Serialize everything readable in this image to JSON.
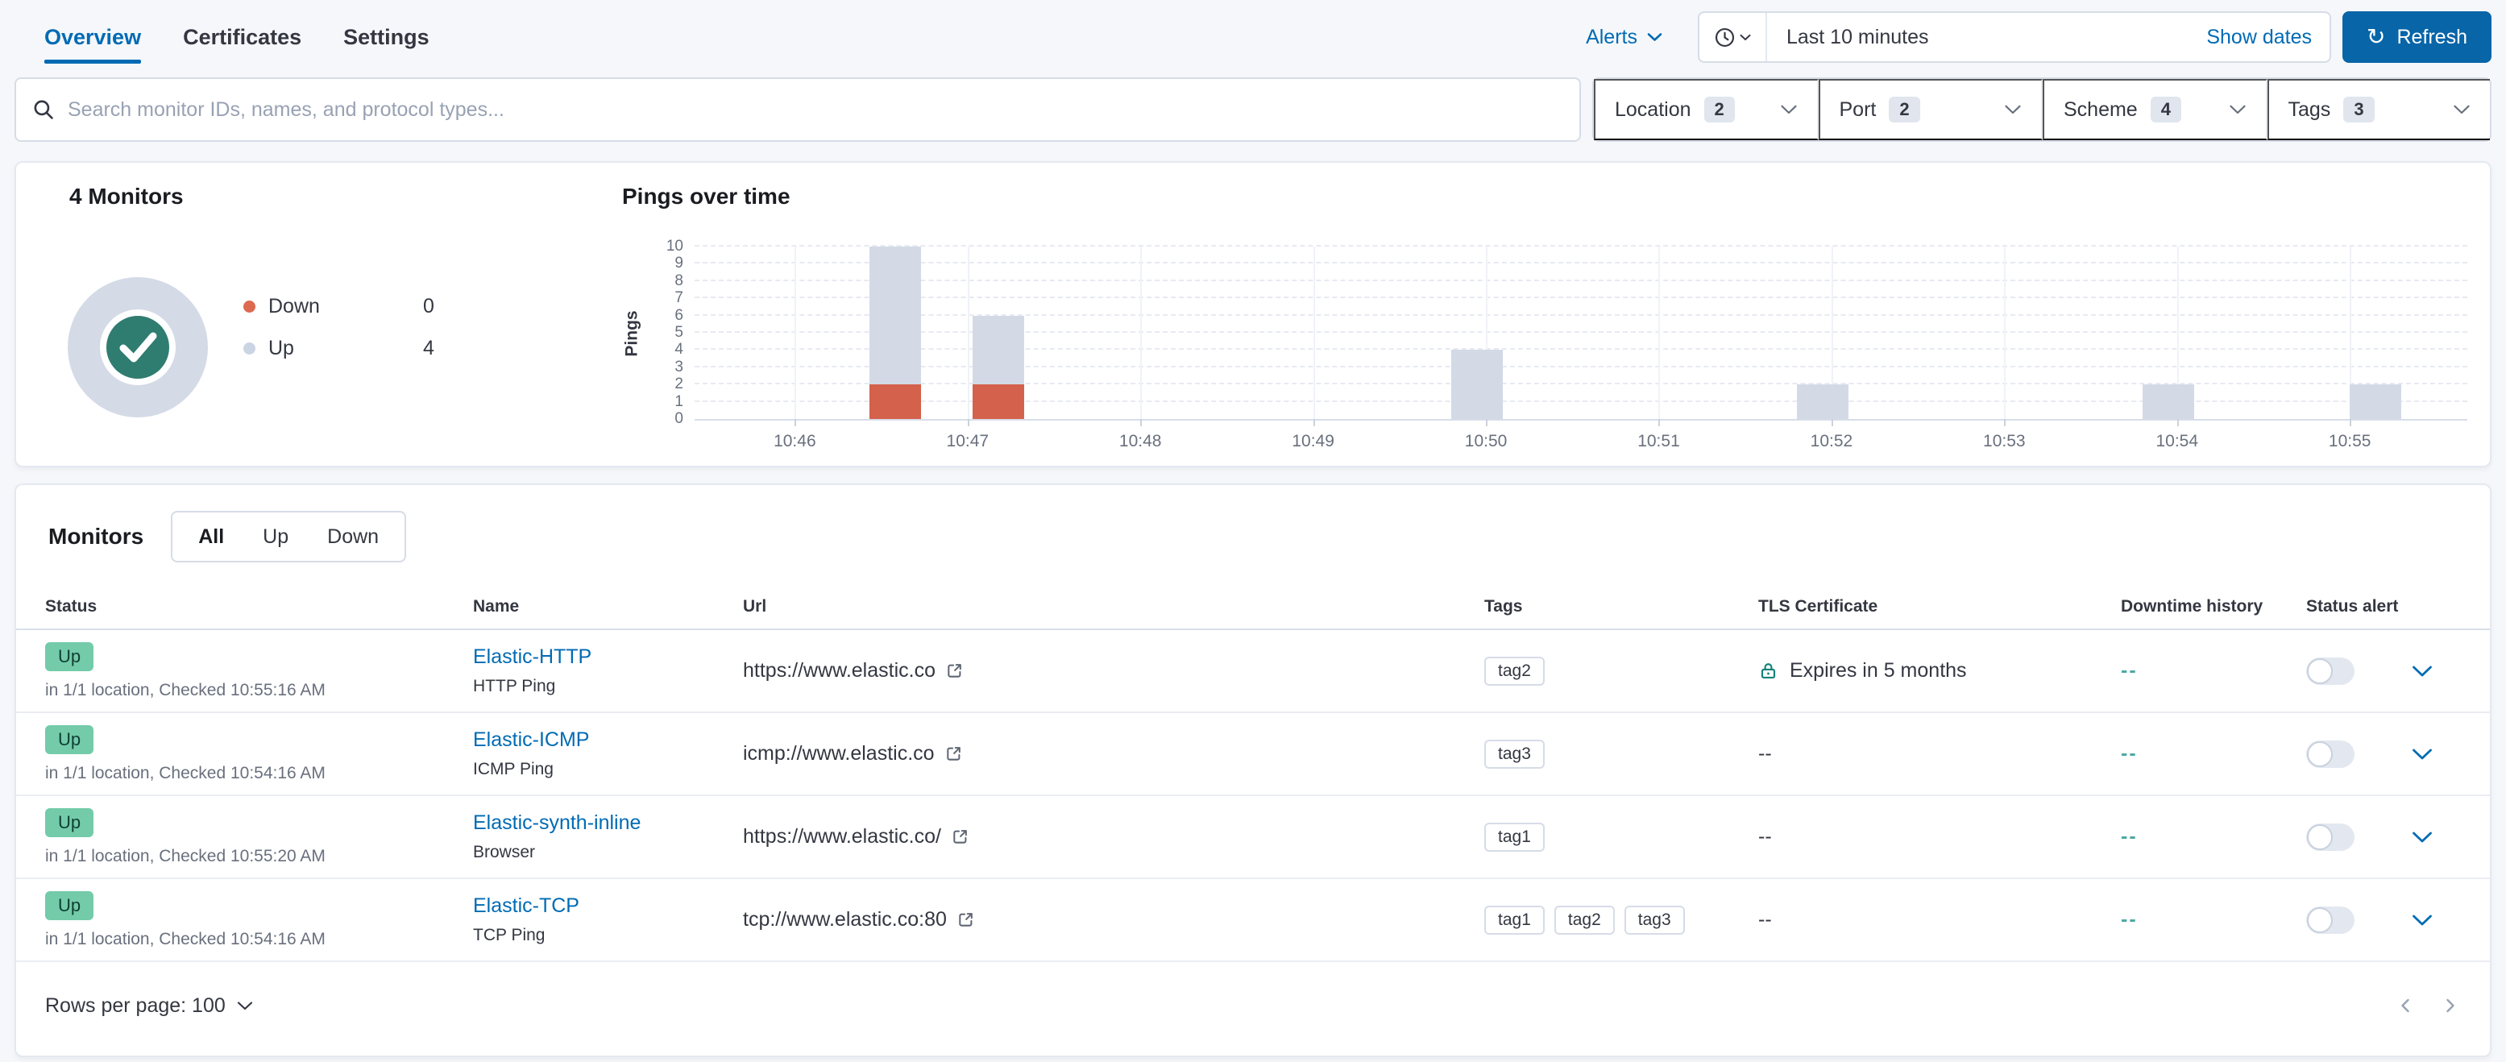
{
  "header": {
    "tabs": [
      {
        "label": "Overview",
        "active": true
      },
      {
        "label": "Certificates",
        "active": false
      },
      {
        "label": "Settings",
        "active": false
      }
    ],
    "alerts_label": "Alerts",
    "time_range": "Last 10 minutes",
    "show_dates_label": "Show dates",
    "refresh_label": "Refresh"
  },
  "search": {
    "placeholder": "Search monitor IDs, names, and protocol types..."
  },
  "filters": [
    {
      "label": "Location",
      "count": "2"
    },
    {
      "label": "Port",
      "count": "2"
    },
    {
      "label": "Scheme",
      "count": "4"
    },
    {
      "label": "Tags",
      "count": "3"
    }
  ],
  "overview": {
    "title": "4 Monitors",
    "donut": {
      "ring_color": "#D4DAE6",
      "check_color": "#2F7D70"
    },
    "legend": [
      {
        "label": "Down",
        "value": "0",
        "color": "#DC6A51"
      },
      {
        "label": "Up",
        "value": "4",
        "color": "#CBD4E3"
      }
    ]
  },
  "chart_data": {
    "type": "stacked-bar",
    "title": "Pings over time",
    "xlabel": "",
    "ylabel": "Pings",
    "ylim": [
      0,
      10
    ],
    "yticks": [
      0,
      1,
      2,
      3,
      4,
      5,
      6,
      7,
      8,
      9,
      10
    ],
    "grid": "horizontal-dashed",
    "legend_position": "none",
    "x_domain": [
      45.42,
      55.68
    ],
    "xticks": [
      {
        "t": 46,
        "label": "10:46"
      },
      {
        "t": 47,
        "label": "10:47"
      },
      {
        "t": 48,
        "label": "10:48"
      },
      {
        "t": 49,
        "label": "10:49"
      },
      {
        "t": 50,
        "label": "10:50"
      },
      {
        "t": 51,
        "label": "10:51"
      },
      {
        "t": 52,
        "label": "10:52"
      },
      {
        "t": 53,
        "label": "10:53"
      },
      {
        "t": 54,
        "label": "10:54"
      },
      {
        "t": 55,
        "label": "10:55"
      }
    ],
    "series": [
      {
        "name": "Up",
        "color": "#D3DAE6"
      },
      {
        "name": "Down",
        "color": "#D4614B"
      }
    ],
    "bars": [
      {
        "t": 46.58,
        "up": 8,
        "down": 2
      },
      {
        "t": 47.18,
        "up": 4,
        "down": 2
      },
      {
        "t": 49.95,
        "up": 4,
        "down": 0
      },
      {
        "t": 51.95,
        "up": 2,
        "down": 0
      },
      {
        "t": 53.95,
        "up": 2,
        "down": 0
      },
      {
        "t": 55.15,
        "up": 2,
        "down": 0
      }
    ]
  },
  "monitors": {
    "title": "Monitors",
    "tabs": [
      {
        "label": "All",
        "active": true
      },
      {
        "label": "Up",
        "active": false
      },
      {
        "label": "Down",
        "active": false
      }
    ],
    "columns": [
      "Status",
      "Name",
      "Url",
      "Tags",
      "TLS Certificate",
      "Downtime history",
      "Status alert"
    ],
    "rows": [
      {
        "status": "Up",
        "status_detail": "in 1/1 location, Checked 10:55:16 AM",
        "name": "Elastic-HTTP",
        "type": "HTTP Ping",
        "url": "https://www.elastic.co",
        "tags": [
          "tag2"
        ],
        "tls": "Expires in 5 months",
        "tls_lock": true,
        "downtime": "--",
        "alert_enabled": false
      },
      {
        "status": "Up",
        "status_detail": "in 1/1 location, Checked 10:54:16 AM",
        "name": "Elastic-ICMP",
        "type": "ICMP Ping",
        "url": "icmp://www.elastic.co",
        "tags": [
          "tag3"
        ],
        "tls": "--",
        "tls_lock": false,
        "downtime": "--",
        "alert_enabled": false
      },
      {
        "status": "Up",
        "status_detail": "in 1/1 location, Checked 10:55:20 AM",
        "name": "Elastic-synth-inline",
        "type": "Browser",
        "url": "https://www.elastic.co/",
        "tags": [
          "tag1"
        ],
        "tls": "--",
        "tls_lock": false,
        "downtime": "--",
        "alert_enabled": false
      },
      {
        "status": "Up",
        "status_detail": "in 1/1 location, Checked 10:54:16 AM",
        "name": "Elastic-TCP",
        "type": "TCP Ping",
        "url": "tcp://www.elastic.co:80",
        "tags": [
          "tag1",
          "tag2",
          "tag3"
        ],
        "tls": "--",
        "tls_lock": false,
        "downtime": "--",
        "alert_enabled": false
      }
    ],
    "footer": {
      "rows_per_page_label": "Rows per page: 100"
    }
  },
  "colors": {
    "primary": "#006BB4",
    "success_badge_bg": "#73CBA9",
    "chart_up": "#D3DAE6",
    "chart_down": "#D4614B",
    "donut_check": "#2F7D70",
    "downtime_teal": "#4EA9A4"
  }
}
